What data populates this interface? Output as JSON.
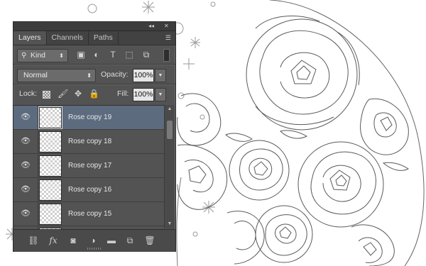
{
  "panel": {
    "tabs": [
      {
        "label": "Layers",
        "active": true
      },
      {
        "label": "Channels",
        "active": false
      },
      {
        "label": "Paths",
        "active": false
      }
    ],
    "filter": {
      "kind_label": "Kind"
    },
    "blend_mode": "Normal",
    "opacity_label": "Opacity:",
    "opacity_value": "100%",
    "lock_label": "Lock:",
    "fill_label": "Fill:",
    "fill_value": "100%",
    "layers": [
      {
        "name": "Rose copy 19",
        "selected": true
      },
      {
        "name": "Rose copy 18",
        "selected": false
      },
      {
        "name": "Rose copy 17",
        "selected": false
      },
      {
        "name": "Rose copy 16",
        "selected": false
      },
      {
        "name": "Rose copy 15",
        "selected": false
      }
    ],
    "icons": {
      "search": "magnifier-icon",
      "eye": "eye-icon",
      "bottom": [
        "link-icon",
        "fx-icon",
        "mask-icon",
        "adjustment-icon",
        "folder-icon",
        "new-layer-icon",
        "trash-icon"
      ]
    },
    "accent_colors": {
      "panel_bg": "#535353",
      "selected_row": "#5c6b7e"
    }
  }
}
